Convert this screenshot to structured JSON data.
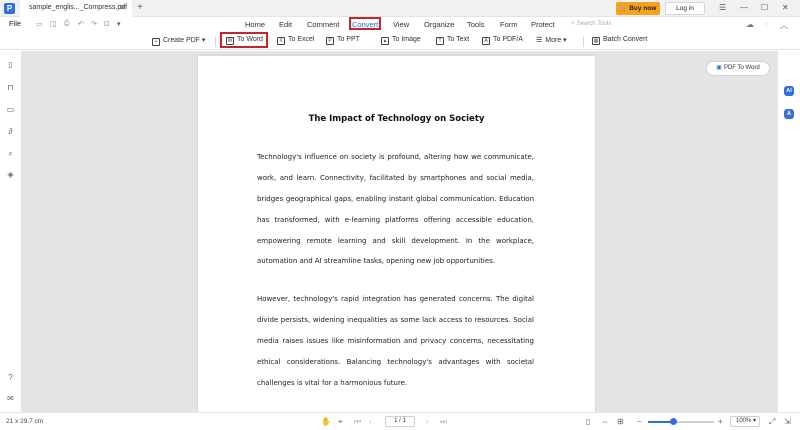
{
  "window": {
    "tab_title": "sample_englis..._Compress.pdf",
    "buy_now": "Buy now",
    "log_in": "Log in"
  },
  "menubar": {
    "file": "File",
    "items": [
      "Home",
      "Edit",
      "Comment",
      "Convert",
      "View",
      "Organize",
      "Tools",
      "Form",
      "Protect"
    ],
    "active": "Convert",
    "search_placeholder": "Search Tools"
  },
  "toolbar": {
    "create_pdf": "Create PDF",
    "to_word": "To Word",
    "to_excel": "To Excel",
    "to_ppt": "To PPT",
    "to_image": "To Image",
    "to_text": "To Text",
    "to_pdfa": "To PDF/A",
    "more": "More",
    "batch_convert": "Batch Convert"
  },
  "document": {
    "title": "The Impact of Technology on Society",
    "paragraph1": [
      "Technology's influence on society is profound, altering how we communicate,",
      "work, and learn. Connectivity, facilitated by smartphones and social media,",
      "bridges geographical gaps, enabling instant global communication. Education",
      "has transformed, with e-learning platforms offering accessible education,",
      "empowering remote learning and skill development. In the workplace,",
      "automation and AI streamline tasks, opening new job opportunities."
    ],
    "paragraph2": [
      "However, technology's rapid integration has generated concerns. The digital",
      "divide persists, widening inequalities as some lack access to resources. Social",
      "media raises issues like misinformation and privacy concerns, necessitating",
      "ethical considerations. Balancing technology's advantages with societal",
      "challenges is vital for a harmonious future."
    ]
  },
  "floating": {
    "pdf_to_word": "PDF To Word"
  },
  "rightbar": {
    "ai_label": "AI",
    "translate_label": "A"
  },
  "statusbar": {
    "page_size": "21 x 29.7 cm",
    "page_indicator": "1 / 1",
    "zoom": "100%",
    "zoom_fraction": 0.38
  },
  "colors": {
    "accent": "#2c6fe0",
    "highlight_box": "#c1272d",
    "buy_button": "#f7a21a"
  }
}
